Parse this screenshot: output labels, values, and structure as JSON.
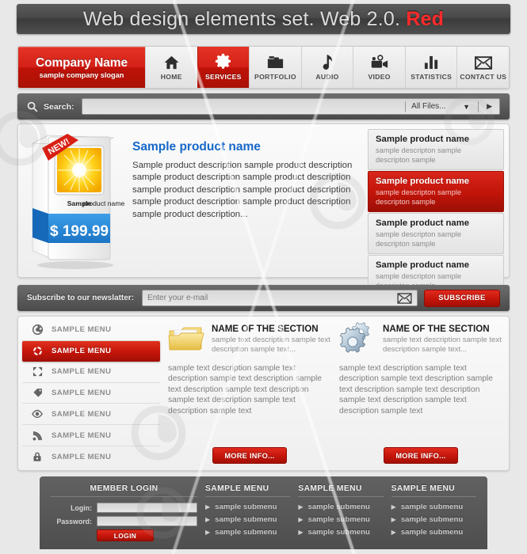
{
  "title_bar": {
    "text": "Web design elements set. Web 2.0. ",
    "highlight": "Red"
  },
  "nav": {
    "brand_name": "Company Name",
    "brand_slogan": "sample company slogan",
    "items": [
      {
        "label": "HOME",
        "icon": "home-icon",
        "active": false
      },
      {
        "label": "SERVICES",
        "icon": "gear-icon",
        "active": true
      },
      {
        "label": "PORTFOLIO",
        "icon": "folder-icon",
        "active": false
      },
      {
        "label": "AUDIO",
        "icon": "music-note-icon",
        "active": false
      },
      {
        "label": "VIDEO",
        "icon": "camcorder-icon",
        "active": false
      },
      {
        "label": "STATISTICS",
        "icon": "bar-chart-icon",
        "active": false
      },
      {
        "label": "CONTACT US",
        "icon": "envelope-icon",
        "active": false
      }
    ]
  },
  "search": {
    "icon": "search-icon",
    "label": "Search:",
    "value": "",
    "placeholder": "",
    "filter_selected": "All Files...",
    "caret_icon": "chevron-down-icon",
    "go_icon": "play-arrow-icon"
  },
  "product": {
    "box": {
      "ribbon": "NEW!",
      "caption_bold": "Sample",
      "caption_rest": "product name",
      "price": "$ 199.99"
    },
    "name": "Sample product name",
    "description": "Sample product description sample product description sample product description sample product description sample product description sample product description sample product description sample product description sample product description...",
    "list": [
      {
        "name": "Sample product name",
        "desc": "sample descripton sample descripton sample",
        "active": false
      },
      {
        "name": "Sample product name",
        "desc": "sample descripton sample descripton sample",
        "active": true
      },
      {
        "name": "Sample product name",
        "desc": "sample descripton sample descripton sample",
        "active": false
      },
      {
        "name": "Sample product name",
        "desc": "sample descripton sample descripton sample",
        "active": false
      }
    ]
  },
  "newsletter": {
    "label": "Subscribe to our newslatter:",
    "value": "",
    "placeholder": "Enter your e-mail",
    "envelope_icon": "envelope-icon",
    "button": "SUBSCRIBE"
  },
  "side_menu": {
    "items": [
      {
        "label": "SAMPLE MENU",
        "icon": "aperture-icon",
        "active": false
      },
      {
        "label": "SAMPLE MENU",
        "icon": "refresh-icon",
        "active": true
      },
      {
        "label": "SAMPLE MENU",
        "icon": "expand-icon",
        "active": false
      },
      {
        "label": "SAMPLE MENU",
        "icon": "tag-icon",
        "active": false
      },
      {
        "label": "SAMPLE MENU",
        "icon": "eye-icon",
        "active": false
      },
      {
        "label": "SAMPLE MENU",
        "icon": "rss-icon",
        "active": false
      },
      {
        "label": "SAMPLE MENU",
        "icon": "lock-icon",
        "active": false
      }
    ]
  },
  "sections": [
    {
      "icon": "folder-icon",
      "title": "NAME OF THE SECTION",
      "subtitle": "sample text description sample text description sample text...",
      "body": "sample text description sample text description sample text description sample text description sample text description sample text description sample text description sample text",
      "button": "MORE INFO..."
    },
    {
      "icon": "gears-icon",
      "title": "NAME OF THE SECTION",
      "subtitle": "sample text description sample text description sample text...",
      "body": "sample text description sample text description sample text description sample text description sample text description sample text description sample text description sample text",
      "button": "MORE INFO..."
    }
  ],
  "footer": {
    "login": {
      "heading": "MEMBER LOGIN",
      "login_label": "Login:",
      "login_value": "",
      "password_label": "Password:",
      "password_value": "",
      "button": "LOGIN"
    },
    "columns": [
      {
        "heading": "SAMPLE MENU",
        "links": [
          "sample submenu",
          "sample submenu",
          "sample submenu"
        ]
      },
      {
        "heading": "SAMPLE MENU",
        "links": [
          "sample submenu",
          "sample submenu",
          "sample submenu"
        ]
      },
      {
        "heading": "SAMPLE MENU",
        "links": [
          "sample submenu",
          "sample submenu",
          "sample submenu"
        ]
      }
    ]
  },
  "colors": {
    "accent_red": "#c4150a",
    "bright_red": "#ff2b2b",
    "link_blue": "#1668c8",
    "dark_bar": "#4a4a4a",
    "page_bg": "#e8e8e8"
  }
}
